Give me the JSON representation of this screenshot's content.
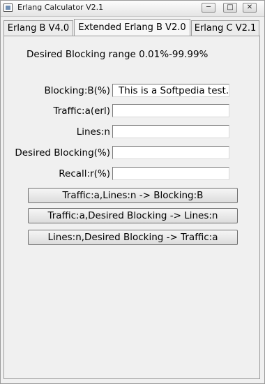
{
  "window": {
    "title": "Erlang Calculator V2.1",
    "controls": {
      "minimize": "─",
      "maximize": "□",
      "close": "✕"
    }
  },
  "tabs": [
    {
      "label": "Erlang B V4.0",
      "active": false
    },
    {
      "label": "Extended Erlang B V2.0",
      "active": true
    },
    {
      "label": "Erlang C V2.1",
      "active": false
    }
  ],
  "panel": {
    "range_text": "Desired Blocking range 0.01%-99.99%",
    "fields": [
      {
        "label": "Blocking:B(%)",
        "value": "This is a Softpedia test."
      },
      {
        "label": "Traffic:a(erl)",
        "value": ""
      },
      {
        "label": "Lines:n",
        "value": ""
      },
      {
        "label": "Desired Blocking(%)",
        "value": ""
      },
      {
        "label": "Recall:r(%)",
        "value": ""
      }
    ],
    "buttons": [
      "Traffic:a,Lines:n -> Blocking:B",
      "Traffic:a,Desired Blocking -> Lines:n",
      "Lines:n,Desired Blocking -> Traffic:a"
    ]
  }
}
